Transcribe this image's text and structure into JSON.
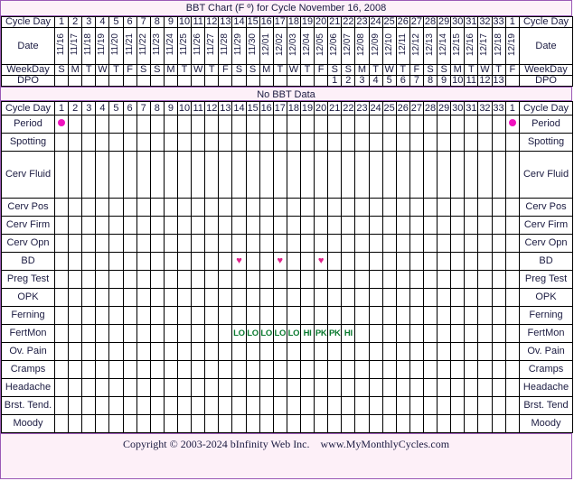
{
  "title": "BBT Chart (F º) for Cycle November 16, 2008",
  "no_bbt_data": "No BBT Data",
  "row_labels": {
    "cycle_day": "Cycle Day",
    "date": "Date",
    "weekday": "WeekDay",
    "dpo": "DPO",
    "period": "Period",
    "spotting": "Spotting",
    "cerv_fluid": "Cerv Fluid",
    "cerv_pos": "Cerv Pos",
    "cerv_firm": "Cerv Firm",
    "cerv_opn": "Cerv Opn",
    "bd": "BD",
    "preg_test": "Preg Test",
    "opk": "OPK",
    "ferning": "Ferning",
    "fertmon": "FertMon",
    "ov_pain": "Ov. Pain",
    "cramps": "Cramps",
    "headache": "Headache",
    "brst_tend": "Brst. Tend.",
    "brst_tend_right": "Brst. Tend",
    "moody": "Moody"
  },
  "columns": {
    "count": 34,
    "cycle_days": [
      "1",
      "2",
      "3",
      "4",
      "5",
      "6",
      "7",
      "8",
      "9",
      "10",
      "11",
      "12",
      "13",
      "14",
      "15",
      "16",
      "17",
      "18",
      "19",
      "20",
      "21",
      "22",
      "23",
      "24",
      "25",
      "26",
      "27",
      "28",
      "29",
      "30",
      "31",
      "32",
      "33",
      "1"
    ],
    "dates": [
      "11/16",
      "11/17",
      "11/18",
      "11/19",
      "11/20",
      "11/21",
      "11/22",
      "11/23",
      "11/24",
      "11/25",
      "11/26",
      "11/27",
      "11/28",
      "11/29",
      "11/30",
      "12/01",
      "12/02",
      "12/03",
      "12/04",
      "12/05",
      "12/06",
      "12/07",
      "12/08",
      "12/09",
      "12/10",
      "12/11",
      "12/12",
      "12/13",
      "12/14",
      "12/15",
      "12/16",
      "12/17",
      "12/18",
      "12/19"
    ],
    "weekdays": [
      "S",
      "M",
      "T",
      "W",
      "T",
      "F",
      "S",
      "S",
      "M",
      "T",
      "W",
      "T",
      "F",
      "S",
      "S",
      "M",
      "T",
      "W",
      "T",
      "F",
      "S",
      "S",
      "M",
      "T",
      "W",
      "T",
      "F",
      "S",
      "S",
      "M",
      "T",
      "W",
      "T",
      "F"
    ],
    "dpo": [
      "",
      "",
      "",
      "",
      "",
      "",
      "",
      "",
      "",
      "",
      "",
      "",
      "",
      "",
      "",
      "",
      "",
      "",
      "",
      "",
      "1",
      "2",
      "3",
      "4",
      "5",
      "6",
      "7",
      "8",
      "9",
      "10",
      "11",
      "12",
      "13",
      ""
    ]
  },
  "data_rows": {
    "period": [
      "●",
      "",
      "",
      "",
      "",
      "",
      "",
      "",
      "",
      "",
      "",
      "",
      "",
      "",
      "",
      "",
      "",
      "",
      "",
      "",
      "",
      "",
      "",
      "",
      "",
      "",
      "",
      "",
      "",
      "",
      "",
      "",
      "",
      "●"
    ],
    "spotting": [
      "",
      "",
      "",
      "",
      "",
      "",
      "",
      "",
      "",
      "",
      "",
      "",
      "",
      "",
      "",
      "",
      "",
      "",
      "",
      "",
      "",
      "",
      "",
      "",
      "",
      "",
      "",
      "",
      "",
      "",
      "",
      "",
      "",
      ""
    ],
    "cerv_fluid": [
      "",
      "",
      "",
      "",
      "",
      "",
      "",
      "",
      "",
      "",
      "",
      "",
      "",
      "",
      "",
      "",
      "",
      "",
      "",
      "",
      "",
      "",
      "",
      "",
      "",
      "",
      "",
      "",
      "",
      "",
      "",
      "",
      "",
      ""
    ],
    "cerv_pos": [
      "",
      "",
      "",
      "",
      "",
      "",
      "",
      "",
      "",
      "",
      "",
      "",
      "",
      "",
      "",
      "",
      "",
      "",
      "",
      "",
      "",
      "",
      "",
      "",
      "",
      "",
      "",
      "",
      "",
      "",
      "",
      "",
      "",
      ""
    ],
    "cerv_firm": [
      "",
      "",
      "",
      "",
      "",
      "",
      "",
      "",
      "",
      "",
      "",
      "",
      "",
      "",
      "",
      "",
      "",
      "",
      "",
      "",
      "",
      "",
      "",
      "",
      "",
      "",
      "",
      "",
      "",
      "",
      "",
      "",
      "",
      ""
    ],
    "cerv_opn": [
      "",
      "",
      "",
      "",
      "",
      "",
      "",
      "",
      "",
      "",
      "",
      "",
      "",
      "",
      "",
      "",
      "",
      "",
      "",
      "",
      "",
      "",
      "",
      "",
      "",
      "",
      "",
      "",
      "",
      "",
      "",
      "",
      "",
      ""
    ],
    "bd": [
      "",
      "",
      "",
      "",
      "",
      "",
      "",
      "",
      "",
      "",
      "",
      "",
      "",
      "♥",
      "",
      "",
      "♥",
      "",
      "",
      "♥",
      "",
      "",
      "",
      "",
      "",
      "",
      "",
      "",
      "",
      "",
      "",
      "",
      "",
      ""
    ],
    "preg_test": [
      "",
      "",
      "",
      "",
      "",
      "",
      "",
      "",
      "",
      "",
      "",
      "",
      "",
      "",
      "",
      "",
      "",
      "",
      "",
      "",
      "",
      "",
      "",
      "",
      "",
      "",
      "",
      "",
      "",
      "",
      "",
      "",
      "",
      ""
    ],
    "opk": [
      "",
      "",
      "",
      "",
      "",
      "",
      "",
      "",
      "",
      "",
      "",
      "",
      "",
      "",
      "",
      "",
      "",
      "",
      "",
      "",
      "",
      "",
      "",
      "",
      "",
      "",
      "",
      "",
      "",
      "",
      "",
      "",
      "",
      ""
    ],
    "ferning": [
      "",
      "",
      "",
      "",
      "",
      "",
      "",
      "",
      "",
      "",
      "",
      "",
      "",
      "",
      "",
      "",
      "",
      "",
      "",
      "",
      "",
      "",
      "",
      "",
      "",
      "",
      "",
      "",
      "",
      "",
      "",
      "",
      "",
      ""
    ],
    "fertmon": [
      "",
      "",
      "",
      "",
      "",
      "",
      "",
      "",
      "",
      "",
      "",
      "",
      "",
      "LO",
      "LO",
      "LO",
      "LO",
      "LO",
      "HI",
      "PK",
      "PK",
      "HI",
      "",
      "",
      "",
      "",
      "",
      "",
      "",
      "",
      "",
      "",
      "",
      ""
    ],
    "ov_pain": [
      "",
      "",
      "",
      "",
      "",
      "",
      "",
      "",
      "",
      "",
      "",
      "",
      "",
      "",
      "",
      "",
      "",
      "",
      "",
      "",
      "",
      "",
      "",
      "",
      "",
      "",
      "",
      "",
      "",
      "",
      "",
      "",
      "",
      ""
    ],
    "cramps": [
      "",
      "",
      "",
      "",
      "",
      "",
      "",
      "",
      "",
      "",
      "",
      "",
      "",
      "",
      "",
      "",
      "",
      "",
      "",
      "",
      "",
      "",
      "",
      "",
      "",
      "",
      "",
      "",
      "",
      "",
      "",
      "",
      "",
      ""
    ],
    "headache": [
      "",
      "",
      "",
      "",
      "",
      "",
      "",
      "",
      "",
      "",
      "",
      "",
      "",
      "",
      "",
      "",
      "",
      "",
      "",
      "",
      "",
      "",
      "",
      "",
      "",
      "",
      "",
      "",
      "",
      "",
      "",
      "",
      "",
      ""
    ],
    "brst_tend": [
      "",
      "",
      "",
      "",
      "",
      "",
      "",
      "",
      "",
      "",
      "",
      "",
      "",
      "",
      "",
      "",
      "",
      "",
      "",
      "",
      "",
      "",
      "",
      "",
      "",
      "",
      "",
      "",
      "",
      "",
      "",
      "",
      "",
      ""
    ],
    "moody": [
      "",
      "",
      "",
      "",
      "",
      "",
      "",
      "",
      "",
      "",
      "",
      "",
      "",
      "",
      "",
      "",
      "",
      "",
      "",
      "",
      "",
      "",
      "",
      "",
      "",
      "",
      "",
      "",
      "",
      "",
      "",
      "",
      "",
      ""
    ]
  },
  "footer": {
    "copyright": "Copyright © 2003-2024 bInfinity Web Inc.",
    "website": "www.MyMonthlyCycles.com"
  },
  "colors": {
    "border_accent": "#9b59b6",
    "label_bg": "#fdf0f8",
    "header_bg": "#efefef",
    "date_bg": "#fbf8ec",
    "period_dot": "#f012be",
    "heart": "#e0218a",
    "fertmon_text": "#0a7a2f"
  }
}
